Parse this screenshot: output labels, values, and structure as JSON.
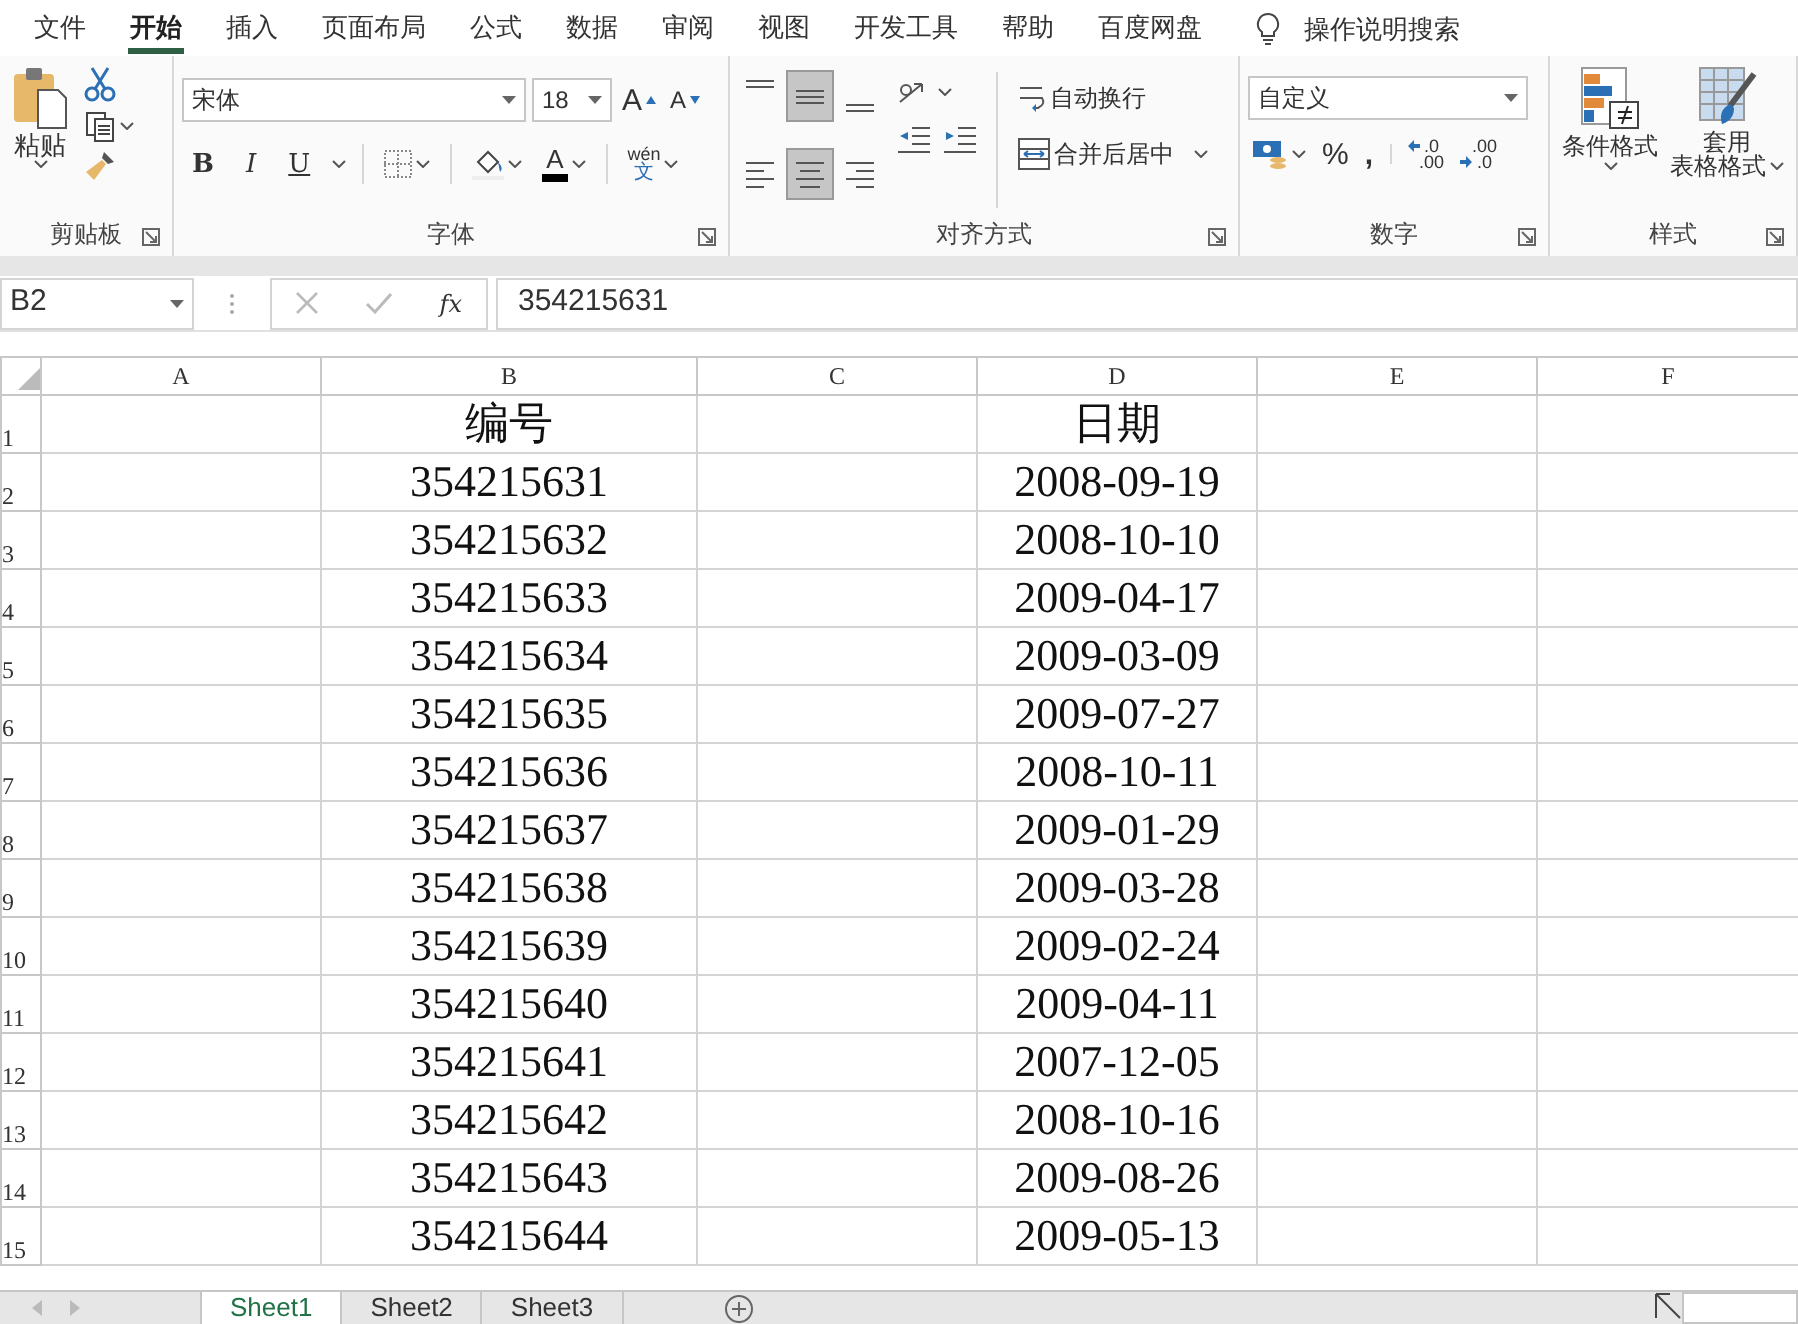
{
  "menu_tabs": [
    {
      "label": "文件",
      "selected": false
    },
    {
      "label": "开始",
      "selected": true
    },
    {
      "label": "插入",
      "selected": false
    },
    {
      "label": "页面布局",
      "selected": false
    },
    {
      "label": "公式",
      "selected": false
    },
    {
      "label": "数据",
      "selected": false
    },
    {
      "label": "审阅",
      "selected": false
    },
    {
      "label": "视图",
      "selected": false
    },
    {
      "label": "开发工具",
      "selected": false
    },
    {
      "label": "帮助",
      "selected": false
    },
    {
      "label": "百度网盘",
      "selected": false
    }
  ],
  "tell_me": "操作说明搜索",
  "ribbon": {
    "clipboard": {
      "title": "剪贴板",
      "paste_label": "粘贴"
    },
    "font": {
      "title": "字体",
      "font_name": "宋体",
      "font_size": "18",
      "grow_label": "A",
      "shrink_label": "A",
      "style_buttons": [
        {
          "kind": "bold",
          "label": "B"
        },
        {
          "kind": "italic",
          "label": "I"
        },
        {
          "kind": "underline",
          "label": "U"
        }
      ],
      "font_color_label": "A",
      "phonetic_top": "wén",
      "phonetic_bottom": "文"
    },
    "alignment": {
      "title": "对齐方式",
      "align_buttons": [
        {
          "kind": "top",
          "selected": false
        },
        {
          "kind": "middle",
          "selected": true
        },
        {
          "kind": "bottom",
          "selected": false
        },
        {
          "kind": "left",
          "selected": false
        },
        {
          "kind": "center",
          "selected": true
        },
        {
          "kind": "right",
          "selected": false
        }
      ],
      "wrap_text": "自动换行",
      "merge_center": "合并后居中"
    },
    "number": {
      "title": "数字",
      "format": "自定义",
      "percent": "%",
      "comma": ",",
      "decimal_buttons": [
        {
          "kind": "increase",
          "top": ".0",
          "bottom": ".00"
        },
        {
          "kind": "decrease",
          "top": ".00",
          "bottom": ".0"
        }
      ]
    },
    "styles": {
      "title": "样式",
      "conditional_format": "条件格式",
      "table_format_top": "套用",
      "table_format_bottom": "表格格式"
    }
  },
  "formula_bar": {
    "name_box": "B2",
    "function_label": "fx",
    "formula": "354215631"
  },
  "columns": [
    "A",
    "B",
    "C",
    "D",
    "E",
    "F"
  ],
  "rows": [
    {
      "number": "1",
      "cells": [
        "",
        "编号",
        "",
        "日期",
        "",
        ""
      ]
    },
    {
      "number": "2",
      "cells": [
        "",
        "354215631",
        "",
        "2008-09-19",
        "",
        ""
      ]
    },
    {
      "number": "3",
      "cells": [
        "",
        "354215632",
        "",
        "2008-10-10",
        "",
        ""
      ]
    },
    {
      "number": "4",
      "cells": [
        "",
        "354215633",
        "",
        "2009-04-17",
        "",
        ""
      ]
    },
    {
      "number": "5",
      "cells": [
        "",
        "354215634",
        "",
        "2009-03-09",
        "",
        ""
      ]
    },
    {
      "number": "6",
      "cells": [
        "",
        "354215635",
        "",
        "2009-07-27",
        "",
        ""
      ]
    },
    {
      "number": "7",
      "cells": [
        "",
        "354215636",
        "",
        "2008-10-11",
        "",
        ""
      ]
    },
    {
      "number": "8",
      "cells": [
        "",
        "354215637",
        "",
        "2009-01-29",
        "",
        ""
      ]
    },
    {
      "number": "9",
      "cells": [
        "",
        "354215638",
        "",
        "2009-03-28",
        "",
        ""
      ]
    },
    {
      "number": "10",
      "cells": [
        "",
        "354215639",
        "",
        "2009-02-24",
        "",
        ""
      ]
    },
    {
      "number": "11",
      "cells": [
        "",
        "354215640",
        "",
        "2009-04-11",
        "",
        ""
      ]
    },
    {
      "number": "12",
      "cells": [
        "",
        "354215641",
        "",
        "2007-12-05",
        "",
        ""
      ]
    },
    {
      "number": "13",
      "cells": [
        "",
        "354215642",
        "",
        "2008-10-16",
        "",
        ""
      ]
    },
    {
      "number": "14",
      "cells": [
        "",
        "354215643",
        "",
        "2009-08-26",
        "",
        ""
      ]
    },
    {
      "number": "15",
      "cells": [
        "",
        "354215644",
        "",
        "2009-05-13",
        "",
        ""
      ]
    }
  ],
  "sheet_tabs": [
    {
      "label": "Sheet1",
      "selected": true
    },
    {
      "label": "Sheet2",
      "selected": false
    },
    {
      "label": "Sheet3",
      "selected": false
    }
  ]
}
